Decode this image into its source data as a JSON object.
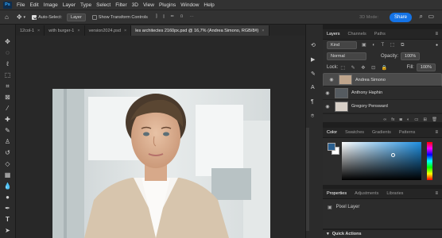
{
  "menubar": {
    "logo": "Ps",
    "items": [
      "File",
      "Edit",
      "Image",
      "Layer",
      "Type",
      "Select",
      "Filter",
      "3D",
      "View",
      "Plugins",
      "Window",
      "Help"
    ]
  },
  "options": {
    "auto_select": "Auto-Select:",
    "auto_select_target": "Layer",
    "show_transform": "Show Transform Controls",
    "mode_3d": "3D Mode:",
    "share": "Share"
  },
  "tabs": [
    {
      "label": "12col-1",
      "active": false
    },
    {
      "label": "with burger-1",
      "active": false
    },
    {
      "label": "version2024.psd",
      "active": false
    },
    {
      "label": "les architectes 2160px.psd @ 16,7% (Andrea Simono, RGB/8#)",
      "active": true
    }
  ],
  "layers_panel": {
    "tabs": [
      "Layers",
      "Channels",
      "Paths"
    ],
    "kind_label": "Kind",
    "blend_mode": "Normal",
    "opacity_label": "Opacity:",
    "opacity_value": "100%",
    "lock_label": "Lock:",
    "fill_label": "Fill:",
    "fill_value": "100%",
    "layers": [
      {
        "name": "Andrea Simono",
        "selected": true
      },
      {
        "name": "Anthony Haphin",
        "selected": false
      },
      {
        "name": "Gregory Pensward",
        "selected": false
      }
    ]
  },
  "color_panel": {
    "tabs": [
      "Color",
      "Swatches",
      "Gradients",
      "Patterns"
    ],
    "hue_color": "#1e8fe0"
  },
  "properties_panel": {
    "tabs": [
      "Properties",
      "Adjustments",
      "Libraries"
    ],
    "pixel_layer": "Pixel Layer"
  },
  "quick_actions": "Quick Actions",
  "colors": {
    "accent": "#1473e6",
    "foreground_swatch": "#2a5f8f",
    "background_swatch": "#ffffff"
  }
}
